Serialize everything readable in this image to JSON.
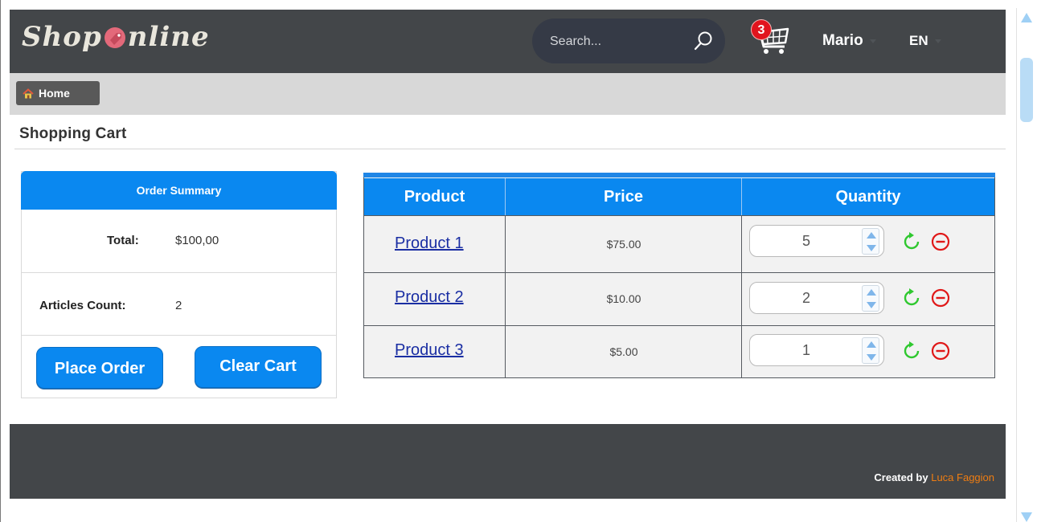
{
  "header": {
    "logo_part1": "Shop",
    "logo_part2": "nline",
    "search": {
      "placeholder": "Search..."
    },
    "cart": {
      "count": "3"
    },
    "user": {
      "name": "Mario"
    },
    "language": {
      "selected": "EN"
    }
  },
  "breadcrumb": {
    "home_label": "Home"
  },
  "page": {
    "title": "Shopping Cart"
  },
  "order_summary": {
    "header": "Order Summary",
    "total_label": "Total:",
    "total_value": "$100,00",
    "articles_label": "Articles Count:",
    "articles_value": "2",
    "place_order_label": "Place Order",
    "clear_cart_label": "Clear Cart"
  },
  "cart_table": {
    "columns": [
      "Product",
      "Price",
      "Quantity"
    ],
    "rows": [
      {
        "product": "Product 1",
        "price": "$75.00",
        "quantity": "5"
      },
      {
        "product": "Product 2",
        "price": "$10.00",
        "quantity": "2"
      },
      {
        "product": "Product 3",
        "price": "$5.00",
        "quantity": "1"
      }
    ]
  },
  "footer": {
    "credit_prefix": "Created by",
    "credit_author": "Luca Faggion"
  },
  "colors": {
    "primary_blue": "#0a88f0",
    "header_dark": "#434649",
    "refresh_green": "#2fc82f",
    "remove_red": "#e01818",
    "badge_red": "#e1141e",
    "footer_accent": "#ef7d12"
  },
  "icons": {
    "search": "search-icon",
    "cart": "cart-icon",
    "home": "home-icon",
    "refresh": "refresh-icon",
    "remove": "remove-icon"
  }
}
